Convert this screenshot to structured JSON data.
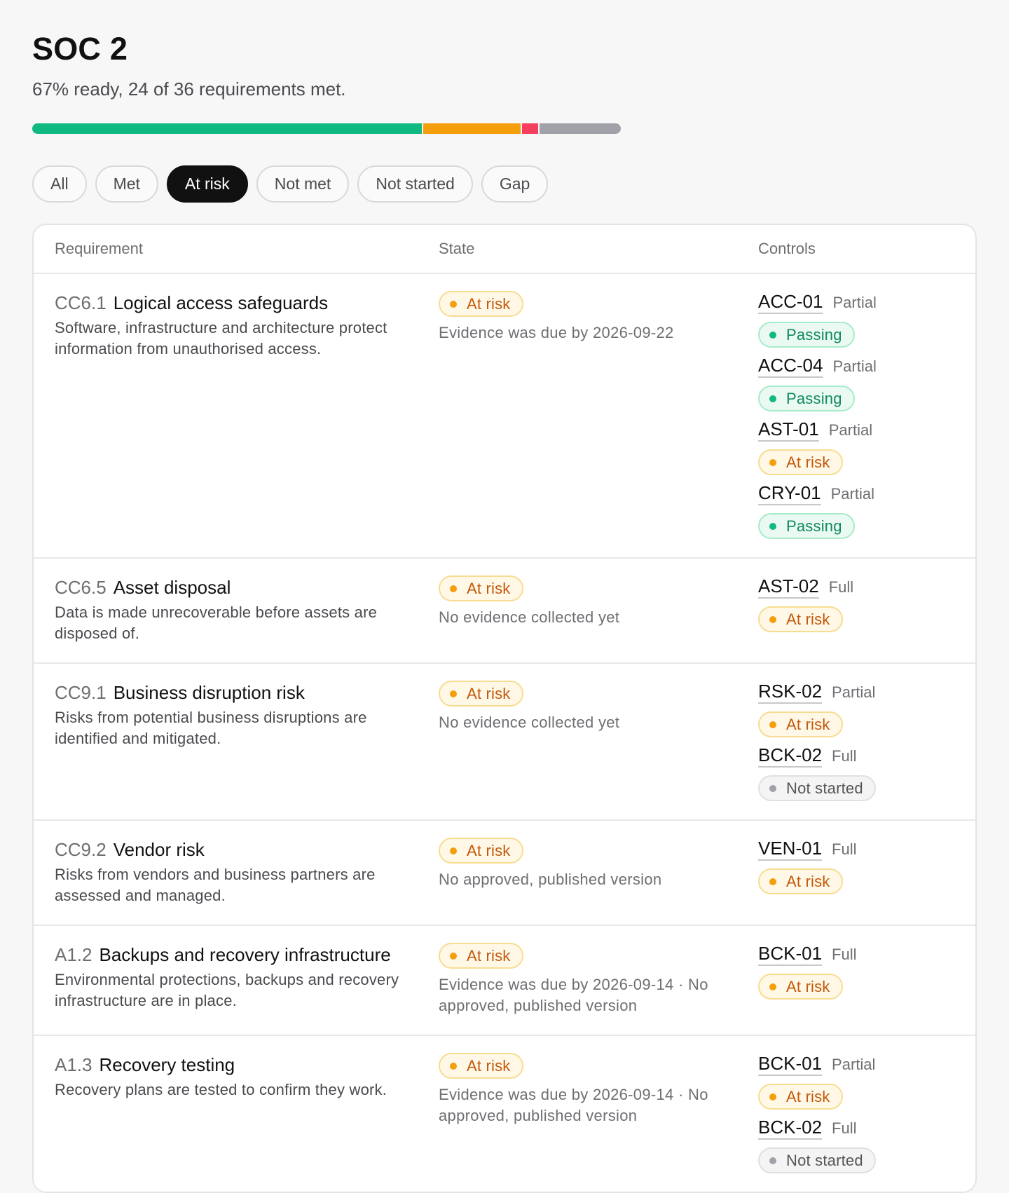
{
  "header": {
    "title": "SOC 2",
    "subtitle": "67% ready, 24 of 36 requirements met."
  },
  "progress": {
    "segments": [
      {
        "name": "met",
        "count": 24,
        "color": "#10b981"
      },
      {
        "name": "at-risk",
        "count": 6,
        "color": "#f59e0b"
      },
      {
        "name": "not-met",
        "count": 1,
        "color": "#f43f5e"
      },
      {
        "name": "not-started",
        "count": 5,
        "color": "#a1a1aa"
      }
    ]
  },
  "filters": {
    "all": "All",
    "met": "Met",
    "at_risk": "At risk",
    "not_met": "Not met",
    "not_started": "Not started",
    "gap": "Gap",
    "active": "At risk"
  },
  "table": {
    "columns": {
      "requirement": "Requirement",
      "state": "State",
      "controls": "Controls"
    },
    "rows": [
      {
        "code": "CC6.1",
        "name": "Logical access safeguards",
        "description": "Software, infrastructure and architecture protect information from unauthorised access.",
        "state": "At risk",
        "state_note": "Evidence was due by 2026-09-22",
        "controls": [
          {
            "id": "ACC-01",
            "coverage": "Partial",
            "status": "Passing",
            "kind": "passing"
          },
          {
            "id": "ACC-04",
            "coverage": "Partial",
            "status": "Passing",
            "kind": "passing"
          },
          {
            "id": "AST-01",
            "coverage": "Partial",
            "status": "At risk",
            "kind": "atrisk"
          },
          {
            "id": "CRY-01",
            "coverage": "Partial",
            "status": "Passing",
            "kind": "passing"
          }
        ]
      },
      {
        "code": "CC6.5",
        "name": "Asset disposal",
        "description": "Data is made unrecoverable before assets are disposed of.",
        "state": "At risk",
        "state_note": "No evidence collected yet",
        "controls": [
          {
            "id": "AST-02",
            "coverage": "Full",
            "status": "At risk",
            "kind": "atrisk"
          }
        ]
      },
      {
        "code": "CC9.1",
        "name": "Business disruption risk",
        "description": "Risks from potential business disruptions are identified and mitigated.",
        "state": "At risk",
        "state_note": "No evidence collected yet",
        "controls": [
          {
            "id": "RSK-02",
            "coverage": "Partial",
            "status": "At risk",
            "kind": "atrisk"
          },
          {
            "id": "BCK-02",
            "coverage": "Full",
            "status": "Not started",
            "kind": "notstarted"
          }
        ]
      },
      {
        "code": "CC9.2",
        "name": "Vendor risk",
        "description": "Risks from vendors and business partners are assessed and managed.",
        "state": "At risk",
        "state_note": "No approved, published version",
        "controls": [
          {
            "id": "VEN-01",
            "coverage": "Full",
            "status": "At risk",
            "kind": "atrisk"
          }
        ]
      },
      {
        "code": "A1.2",
        "name": "Backups and recovery infrastructure",
        "description": "Environmental protections, backups and recovery infrastructure are in place.",
        "state": "At risk",
        "state_note": "Evidence was due by 2026-09-14 · No approved, published version",
        "controls": [
          {
            "id": "BCK-01",
            "coverage": "Full",
            "status": "At risk",
            "kind": "atrisk"
          }
        ]
      },
      {
        "code": "A1.3",
        "name": "Recovery testing",
        "description": "Recovery plans are tested to confirm they work.",
        "state": "At risk",
        "state_note": "Evidence was due by 2026-09-14 · No approved, published version",
        "controls": [
          {
            "id": "BCK-01",
            "coverage": "Partial",
            "status": "At risk",
            "kind": "atrisk"
          },
          {
            "id": "BCK-02",
            "coverage": "Full",
            "status": "Not started",
            "kind": "notstarted"
          }
        ]
      }
    ]
  }
}
